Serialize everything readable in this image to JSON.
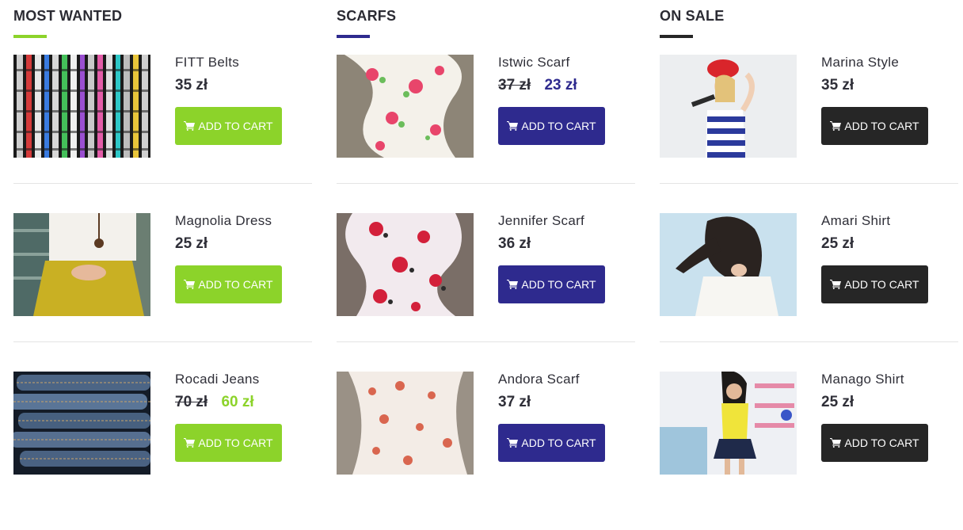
{
  "colors": {
    "green": "#8cd32a",
    "navy": "#2e2a8e",
    "dark": "#262626",
    "text": "#2b2b33"
  },
  "columns": [
    {
      "title": "MOST WANTED",
      "accent": "#8cd32a",
      "products": [
        {
          "name": "FITT Belts",
          "price": "35 zł",
          "old_price": "",
          "image_icon": "belts-photo",
          "button_label": "ADD TO CART"
        },
        {
          "name": "Magnolia Dress",
          "price": "25 zł",
          "old_price": "",
          "image_icon": "dress-photo",
          "button_label": "ADD TO CART"
        },
        {
          "name": "Rocadi Jeans",
          "price": "60 zł",
          "old_price": "70 zł",
          "image_icon": "jeans-photo",
          "button_label": "ADD TO CART"
        }
      ]
    },
    {
      "title": "SCARFS",
      "accent": "#2e2a8e",
      "products": [
        {
          "name": "Istwic Scarf",
          "price": "23 zł",
          "old_price": "37 zł",
          "image_icon": "scarf-photo",
          "button_label": "ADD TO CART"
        },
        {
          "name": "Jennifer Scarf",
          "price": "36 zł",
          "old_price": "",
          "image_icon": "scarf-photo",
          "button_label": "ADD TO CART"
        },
        {
          "name": "Andora Scarf",
          "price": "37 zł",
          "old_price": "",
          "image_icon": "scarf-photo",
          "button_label": "ADD TO CART"
        }
      ]
    },
    {
      "title": "ON SALE",
      "accent": "#262626",
      "products": [
        {
          "name": "Marina Style",
          "price": "35 zł",
          "old_price": "",
          "image_icon": "model-photo",
          "button_label": "ADD TO CART"
        },
        {
          "name": "Amari Shirt",
          "price": "25 zł",
          "old_price": "",
          "image_icon": "model-photo",
          "button_label": "ADD TO CART"
        },
        {
          "name": "Manago Shirt",
          "price": "25 zł",
          "old_price": "",
          "image_icon": "model-photo",
          "button_label": "ADD TO CART"
        }
      ]
    }
  ]
}
